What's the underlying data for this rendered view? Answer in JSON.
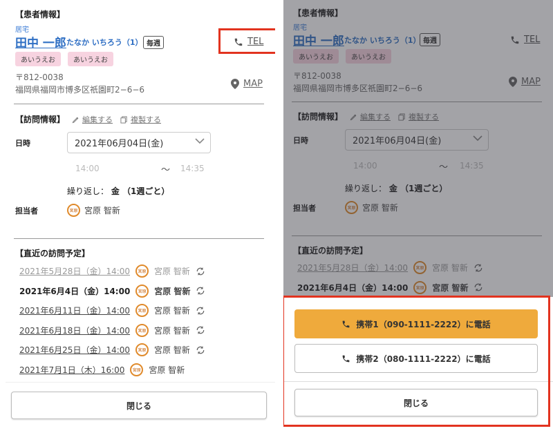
{
  "patient": {
    "section_title": "【患者情報】",
    "residence": "居宅",
    "name": "田中 一郎",
    "kana": "たなか いちろう（1）",
    "frequency": "毎週",
    "tags": [
      "あいうえお",
      "あいうえお"
    ],
    "tel_label": "TEL",
    "postal": "〒812-0038",
    "address": "福岡県福岡市博多区祇園町2−6−6",
    "map_label": "MAP"
  },
  "visit": {
    "section_title": "【訪問情報】",
    "edit_label": "編集する",
    "copy_label": "複製する",
    "datetime_label": "日時",
    "date_value": "2021年06月04日(金)",
    "time_start": "14:00",
    "tilde": "〜",
    "time_end": "14:35",
    "repeat_prefix": "繰り返し：",
    "repeat_value": "金 （1週ごと）",
    "staff_label": "担当者",
    "avatar_text": "宮原",
    "staff_name": "宮原 智新"
  },
  "upcoming": {
    "section_title": "【直近の訪問予定】",
    "staff_name": "宮原 智新",
    "avatar_text": "宮原",
    "items": [
      "2021年5月28日（金）14:00",
      "2021年6月4日（金）14:00",
      "2021年6月11日（金）14:00",
      "2021年6月18日（金）14:00",
      "2021年6月25日（金）14:00",
      "2021年7月1日（木）16:00"
    ]
  },
  "buttons": {
    "close": "閉じる",
    "call1": "携帯1（090-1111-2222）に電話",
    "call2": "携帯2（080-1111-2222）に電話"
  },
  "colors": {
    "accent_orange": "#efaa3c",
    "highlight_red": "#e2331f",
    "link_blue": "#2f6fc4",
    "tag_pink": "#f7d3e0"
  }
}
